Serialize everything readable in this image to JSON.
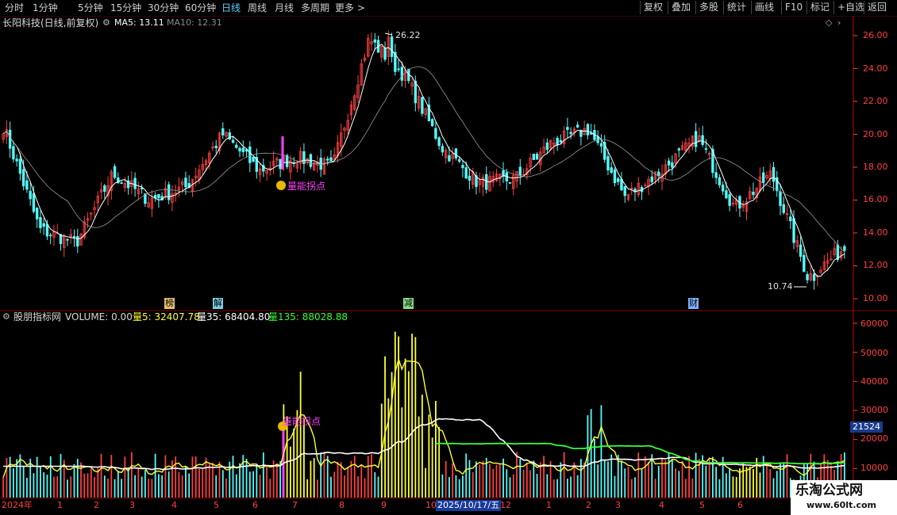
{
  "toolbar": {
    "periods": [
      "分时",
      "1分钟",
      "5分钟",
      "15分钟",
      "30分钟",
      "60分钟",
      "日线",
      "周线",
      "月线",
      "多周期",
      "更多"
    ],
    "active_period": "日线",
    "right_buttons": [
      "复权",
      "叠加",
      "多股",
      "统计",
      "画线",
      "F10",
      "标记",
      "+自选",
      "返回"
    ]
  },
  "price_panel": {
    "stock_title": "长阳科技(日线,前复权)",
    "ma5_label": "MA5: 13.11",
    "ma10_label": "MA10: 12.31",
    "y_ticks": [
      "26.00",
      "24.00",
      "22.00",
      "20.00",
      "18.00",
      "16.00",
      "14.00",
      "12.00",
      "10.00"
    ],
    "high_label": "26.22",
    "low_label": "10.74",
    "signal_label": "量能拐点",
    "event_markers": [
      "榜",
      "解",
      "减",
      "财"
    ]
  },
  "volume_panel": {
    "indicator_name": "股朋指标网",
    "volume_label": "VOLUME: 0.00",
    "ma5_label": "量5: 32407.78",
    "ma35_label": "量35: 68404.80",
    "ma135_label": "量135: 88028.88",
    "y_ticks": [
      "60000",
      "50000",
      "40000",
      "30000",
      "20000",
      "10000"
    ],
    "current_value_label": "21524",
    "signal_label": "量能拐点"
  },
  "date_axis": {
    "labels": [
      "2024年",
      "1",
      "2",
      "3",
      "4",
      "5",
      "6",
      "7",
      "8",
      "9",
      "10",
      "12",
      "1",
      "2",
      "3",
      "4",
      "5",
      "6"
    ],
    "cursor_date": "2025/10/17/五"
  },
  "watermark": {
    "line1": "乐淘公式网",
    "line2": "www.60lt.com"
  },
  "colors": {
    "up": "#ff4040",
    "down": "#54fcfc",
    "yellow": "#ffff33",
    "white": "#ffffff",
    "green": "#33ff33",
    "magenta": "#ff40ff",
    "axis": "#ff4040"
  },
  "chart_data": [
    {
      "type": "candlestick",
      "title": "长阳科技(日线,前复权)",
      "ylim": [
        10,
        26.5
      ],
      "y_ticks": [
        10,
        12,
        14,
        16,
        18,
        20,
        22,
        24,
        26
      ],
      "approx_close_path": [
        {
          "x": "2024-12",
          "y": 20.5
        },
        {
          "x": "2025-01-mid",
          "y": 14.2
        },
        {
          "x": "2025-01-late",
          "y": 13.4
        },
        {
          "x": "2025-02",
          "y": 17.6
        },
        {
          "x": "2025-03",
          "y": 16.0
        },
        {
          "x": "2025-04-early",
          "y": 16.8
        },
        {
          "x": "2025-05",
          "y": 20.0
        },
        {
          "x": "2025-06",
          "y": 17.8
        },
        {
          "x": "2025-07",
          "y": 18.6
        },
        {
          "x": "2025-08",
          "y": 18.0
        },
        {
          "x": "2025-09-early",
          "y": 25.8
        },
        {
          "x": "2025-09-mid",
          "y": 23.5
        },
        {
          "x": "2025-10",
          "y": 19.2
        },
        {
          "x": "2025-11",
          "y": 17.0
        },
        {
          "x": "2025-12",
          "y": 17.3
        },
        {
          "x": "2026-01",
          "y": 19.5
        },
        {
          "x": "2026-02",
          "y": 20.3
        },
        {
          "x": "2026-03",
          "y": 16.2
        },
        {
          "x": "2026-04",
          "y": 17.8
        },
        {
          "x": "2026-05",
          "y": 19.8
        },
        {
          "x": "2026-05-late",
          "y": 15.5
        },
        {
          "x": "2026-06-early",
          "y": 17.6
        },
        {
          "x": "2026-06",
          "y": 11.3
        },
        {
          "x": "2026-06-end",
          "y": 13.1
        }
      ],
      "max": 26.22,
      "min": 10.74,
      "series": [
        {
          "name": "MA5",
          "last": 13.11
        },
        {
          "name": "MA10",
          "last": 12.31
        }
      ]
    },
    {
      "type": "bar",
      "title": "股朋指标网",
      "ylim": [
        0,
        64000
      ],
      "y_ticks": [
        10000,
        20000,
        30000,
        40000,
        50000,
        60000
      ],
      "series": [
        {
          "name": "量5",
          "last": 32407.78
        },
        {
          "name": "量35",
          "last": 68404.8
        },
        {
          "name": "量135",
          "last": 88028.88
        }
      ]
    }
  ]
}
